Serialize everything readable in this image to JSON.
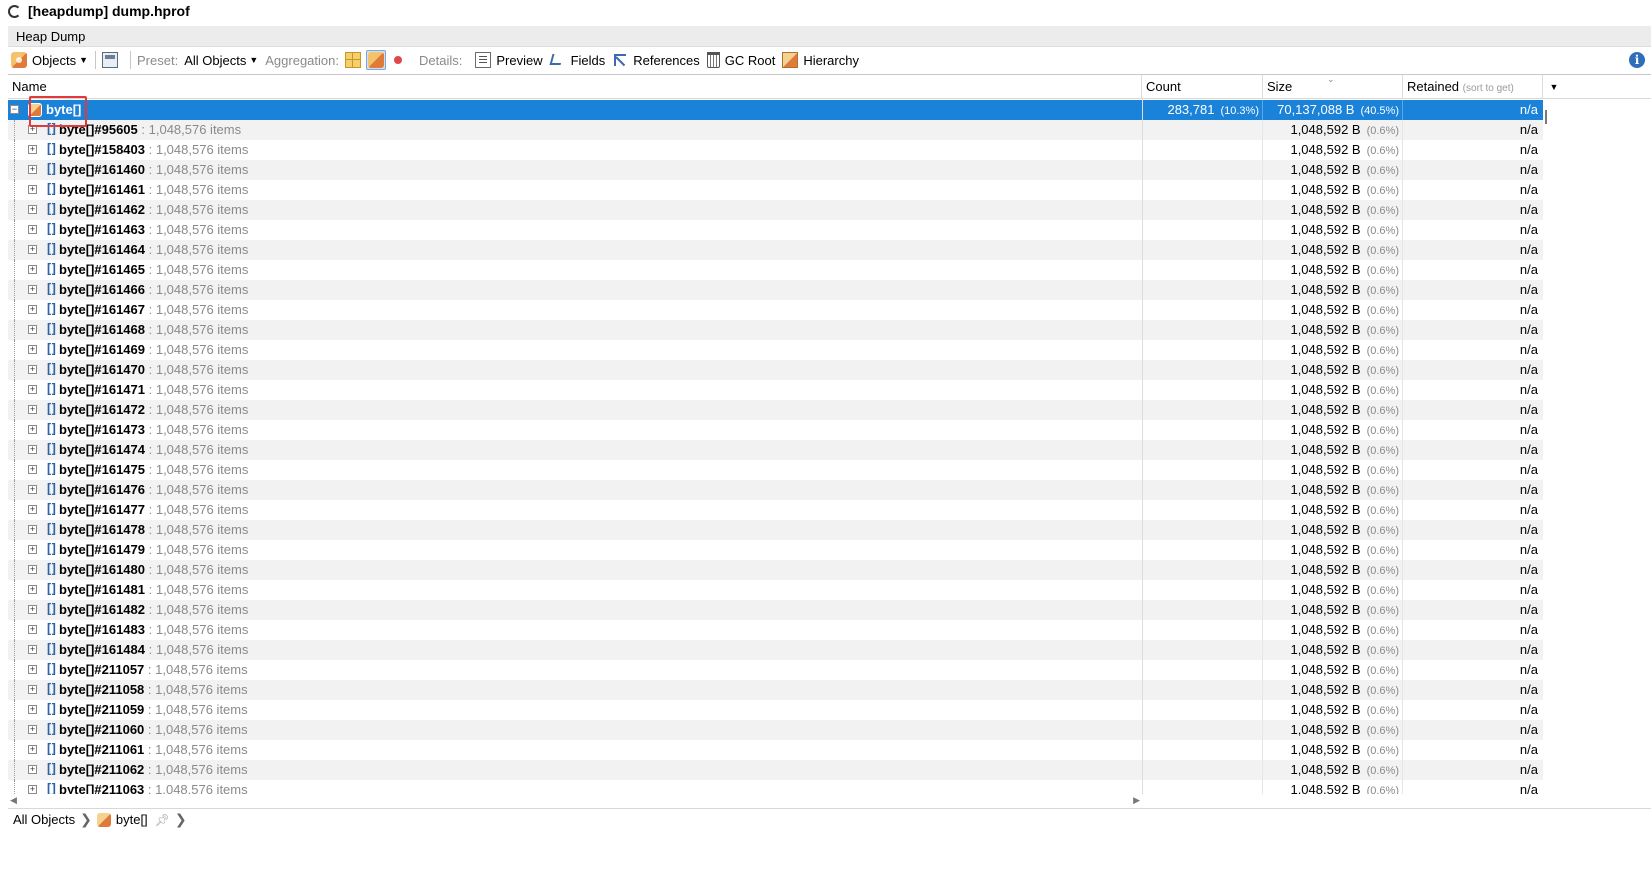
{
  "window": {
    "title": "[heapdump] dump.hprof"
  },
  "tab": {
    "label": "Heap Dump"
  },
  "toolbar": {
    "objects_label": "Objects",
    "preset_label": "Preset:",
    "preset_value": "All Objects",
    "aggregation_label": "Aggregation:",
    "details_label": "Details:",
    "preview_label": "Preview",
    "fields_label": "Fields",
    "references_label": "References",
    "gcroot_label": "GC Root",
    "hierarchy_label": "Hierarchy"
  },
  "columns": {
    "name": "Name",
    "count": "Count",
    "size": "Size",
    "retained": "Retained",
    "retained_hint": "(sort to get)"
  },
  "selected_row": {
    "name": "byte[]",
    "count": "283,781",
    "count_pct": "(10.3%)",
    "size": "70,137,088 B",
    "size_pct": "(40.5%)",
    "retained": "n/a"
  },
  "child_rows": [
    {
      "id": "byte[]#95605",
      "items": " : 1,048,576 items",
      "size": "1,048,592 B",
      "pct": "(0.6%)",
      "retained": "n/a"
    },
    {
      "id": "byte[]#158403",
      "items": " : 1,048,576 items",
      "size": "1,048,592 B",
      "pct": "(0.6%)",
      "retained": "n/a"
    },
    {
      "id": "byte[]#161460",
      "items": " : 1,048,576 items",
      "size": "1,048,592 B",
      "pct": "(0.6%)",
      "retained": "n/a"
    },
    {
      "id": "byte[]#161461",
      "items": " : 1,048,576 items",
      "size": "1,048,592 B",
      "pct": "(0.6%)",
      "retained": "n/a"
    },
    {
      "id": "byte[]#161462",
      "items": " : 1,048,576 items",
      "size": "1,048,592 B",
      "pct": "(0.6%)",
      "retained": "n/a"
    },
    {
      "id": "byte[]#161463",
      "items": " : 1,048,576 items",
      "size": "1,048,592 B",
      "pct": "(0.6%)",
      "retained": "n/a"
    },
    {
      "id": "byte[]#161464",
      "items": " : 1,048,576 items",
      "size": "1,048,592 B",
      "pct": "(0.6%)",
      "retained": "n/a"
    },
    {
      "id": "byte[]#161465",
      "items": " : 1,048,576 items",
      "size": "1,048,592 B",
      "pct": "(0.6%)",
      "retained": "n/a"
    },
    {
      "id": "byte[]#161466",
      "items": " : 1,048,576 items",
      "size": "1,048,592 B",
      "pct": "(0.6%)",
      "retained": "n/a"
    },
    {
      "id": "byte[]#161467",
      "items": " : 1,048,576 items",
      "size": "1,048,592 B",
      "pct": "(0.6%)",
      "retained": "n/a"
    },
    {
      "id": "byte[]#161468",
      "items": " : 1,048,576 items",
      "size": "1,048,592 B",
      "pct": "(0.6%)",
      "retained": "n/a"
    },
    {
      "id": "byte[]#161469",
      "items": " : 1,048,576 items",
      "size": "1,048,592 B",
      "pct": "(0.6%)",
      "retained": "n/a"
    },
    {
      "id": "byte[]#161470",
      "items": " : 1,048,576 items",
      "size": "1,048,592 B",
      "pct": "(0.6%)",
      "retained": "n/a"
    },
    {
      "id": "byte[]#161471",
      "items": " : 1,048,576 items",
      "size": "1,048,592 B",
      "pct": "(0.6%)",
      "retained": "n/a"
    },
    {
      "id": "byte[]#161472",
      "items": " : 1,048,576 items",
      "size": "1,048,592 B",
      "pct": "(0.6%)",
      "retained": "n/a"
    },
    {
      "id": "byte[]#161473",
      "items": " : 1,048,576 items",
      "size": "1,048,592 B",
      "pct": "(0.6%)",
      "retained": "n/a"
    },
    {
      "id": "byte[]#161474",
      "items": " : 1,048,576 items",
      "size": "1,048,592 B",
      "pct": "(0.6%)",
      "retained": "n/a"
    },
    {
      "id": "byte[]#161475",
      "items": " : 1,048,576 items",
      "size": "1,048,592 B",
      "pct": "(0.6%)",
      "retained": "n/a"
    },
    {
      "id": "byte[]#161476",
      "items": " : 1,048,576 items",
      "size": "1,048,592 B",
      "pct": "(0.6%)",
      "retained": "n/a"
    },
    {
      "id": "byte[]#161477",
      "items": " : 1,048,576 items",
      "size": "1,048,592 B",
      "pct": "(0.6%)",
      "retained": "n/a"
    },
    {
      "id": "byte[]#161478",
      "items": " : 1,048,576 items",
      "size": "1,048,592 B",
      "pct": "(0.6%)",
      "retained": "n/a"
    },
    {
      "id": "byte[]#161479",
      "items": " : 1,048,576 items",
      "size": "1,048,592 B",
      "pct": "(0.6%)",
      "retained": "n/a"
    },
    {
      "id": "byte[]#161480",
      "items": " : 1,048,576 items",
      "size": "1,048,592 B",
      "pct": "(0.6%)",
      "retained": "n/a"
    },
    {
      "id": "byte[]#161481",
      "items": " : 1,048,576 items",
      "size": "1,048,592 B",
      "pct": "(0.6%)",
      "retained": "n/a"
    },
    {
      "id": "byte[]#161482",
      "items": " : 1,048,576 items",
      "size": "1,048,592 B",
      "pct": "(0.6%)",
      "retained": "n/a"
    },
    {
      "id": "byte[]#161483",
      "items": " : 1,048,576 items",
      "size": "1,048,592 B",
      "pct": "(0.6%)",
      "retained": "n/a"
    },
    {
      "id": "byte[]#161484",
      "items": " : 1,048,576 items",
      "size": "1,048,592 B",
      "pct": "(0.6%)",
      "retained": "n/a"
    },
    {
      "id": "byte[]#211057",
      "items": " : 1,048,576 items",
      "size": "1,048,592 B",
      "pct": "(0.6%)",
      "retained": "n/a"
    },
    {
      "id": "byte[]#211058",
      "items": " : 1,048,576 items",
      "size": "1,048,592 B",
      "pct": "(0.6%)",
      "retained": "n/a"
    },
    {
      "id": "byte[]#211059",
      "items": " : 1,048,576 items",
      "size": "1,048,592 B",
      "pct": "(0.6%)",
      "retained": "n/a"
    },
    {
      "id": "byte[]#211060",
      "items": " : 1,048,576 items",
      "size": "1,048,592 B",
      "pct": "(0.6%)",
      "retained": "n/a"
    },
    {
      "id": "byte[]#211061",
      "items": " : 1,048,576 items",
      "size": "1,048,592 B",
      "pct": "(0.6%)",
      "retained": "n/a"
    },
    {
      "id": "byte[]#211062",
      "items": " : 1,048,576 items",
      "size": "1,048,592 B",
      "pct": "(0.6%)",
      "retained": "n/a"
    },
    {
      "id": "byte[]#211063",
      "items": " : 1,048,576 items",
      "size": "1,048,592 B",
      "pct": "(0.6%)",
      "retained": "n/a"
    }
  ],
  "breadcrumb": {
    "root": "All Objects",
    "current": "byte[]"
  },
  "colors": {
    "selection": "#1a82d8",
    "highlight_box": "#e23a3a",
    "info": "#2d6fb8"
  }
}
